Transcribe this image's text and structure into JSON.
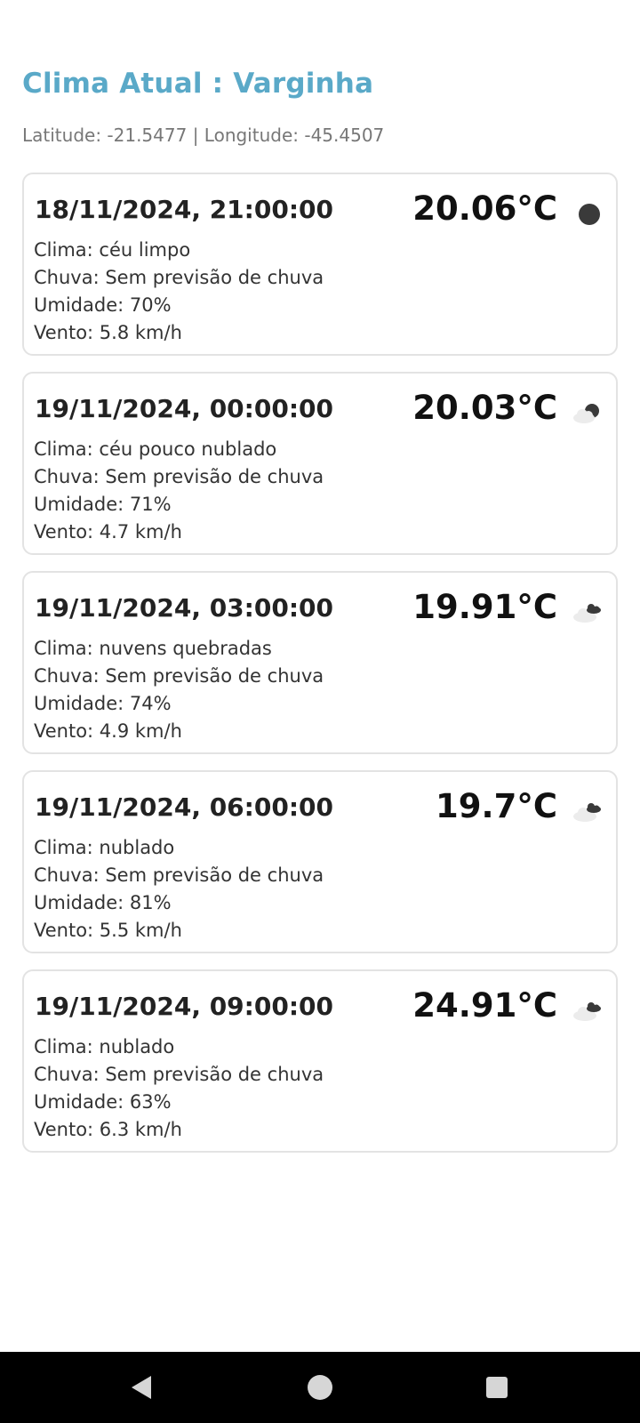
{
  "header": {
    "title": "Clima Atual : Varginha",
    "coordinates": "Latitude: -21.5477 | Longitude: -45.4507"
  },
  "forecasts": [
    {
      "datetime": "18/11/2024, 21:00:00",
      "temperature": "20.06°C",
      "icon": "clear-night-moon-icon",
      "clima": "Clima: céu limpo",
      "chuva": "Chuva: Sem previsão de chuva",
      "umidade": "Umidade: 70%",
      "vento": "Vento: 5.8 km/h"
    },
    {
      "datetime": "19/11/2024, 00:00:00",
      "temperature": "20.03°C",
      "icon": "partly-cloudy-night-icon",
      "clima": "Clima: céu pouco nublado",
      "chuva": "Chuva: Sem previsão de chuva",
      "umidade": "Umidade: 71%",
      "vento": "Vento: 4.7 km/h"
    },
    {
      "datetime": "19/11/2024, 03:00:00",
      "temperature": "19.91°C",
      "icon": "broken-clouds-icon",
      "clima": "Clima: nuvens quebradas",
      "chuva": "Chuva: Sem previsão de chuva",
      "umidade": "Umidade: 74%",
      "vento": "Vento: 4.9 km/h"
    },
    {
      "datetime": "19/11/2024, 06:00:00",
      "temperature": "19.7°C",
      "icon": "overcast-clouds-icon",
      "clima": "Clima: nublado",
      "chuva": "Chuva: Sem previsão de chuva",
      "umidade": "Umidade: 81%",
      "vento": "Vento: 5.5 km/h"
    },
    {
      "datetime": "19/11/2024, 09:00:00",
      "temperature": "24.91°C",
      "icon": "overcast-clouds-icon",
      "clima": "Clima: nublado",
      "chuva": "Chuva: Sem previsão de chuva",
      "umidade": "Umidade: 63%",
      "vento": "Vento: 6.3 km/h"
    }
  ],
  "navigation": {
    "back_icon": "triangle-back-icon",
    "home_icon": "circle-home-icon",
    "recents_icon": "square-recents-icon"
  },
  "colors": {
    "title": "#5aa9c8",
    "nav_bar": "#000000",
    "card_border": "#e3e3e3"
  }
}
